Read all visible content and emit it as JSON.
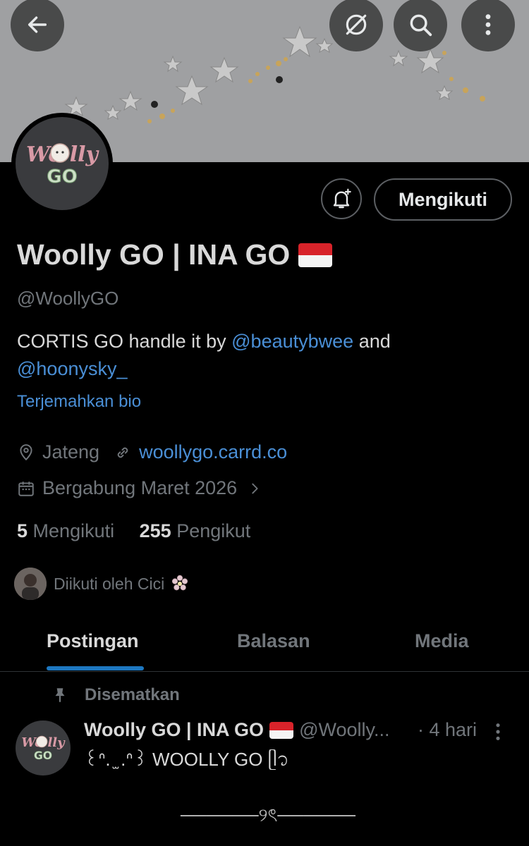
{
  "header": {
    "back_icon": "arrow-left-icon",
    "hide_icon": "eye-slash-icon",
    "search_icon": "search-icon",
    "more_icon": "more-vertical-icon"
  },
  "profile": {
    "avatar_text": "Woolly GO",
    "name": "Woolly GO | INA GO",
    "handle": "@WoollyGO",
    "bio_text": "CORTIS GO handle it by",
    "bio_mention_1": "@beautybwee",
    "bio_and": "and",
    "bio_mention_2": "@hoonysky_",
    "translate_label": "Terjemahkan bio",
    "location": "Jateng",
    "website": "woollygo.carrd.co",
    "joined": "Bergabung Maret 2026",
    "following_count": "5",
    "following_label": "Mengikuti",
    "followers_count": "255",
    "followers_label": "Pengikut",
    "followed_by": "Diikuti oleh Cici"
  },
  "actions": {
    "follow_label": "Mengikuti",
    "notify_icon": "bell-plus-icon"
  },
  "tabs": [
    {
      "label": "Postingan",
      "active": true
    },
    {
      "label": "Balasan",
      "active": false
    },
    {
      "label": "Media",
      "active": false
    }
  ],
  "pinned_post": {
    "pinned_label": "Disematkan",
    "author_name": "Woolly GO | INA GO",
    "author_handle": "@Woolly...",
    "time": "· 4 hari",
    "text": "꒰ᐢ. ̫ .ᐢ꒱ WOOLLY GO ᥫ᭡",
    "deco": "──────୨ৎ──────"
  },
  "colors": {
    "accent": "#1d78c1",
    "link": "#4a8fd6",
    "muted": "#71767b",
    "text": "#d9d9d9"
  }
}
